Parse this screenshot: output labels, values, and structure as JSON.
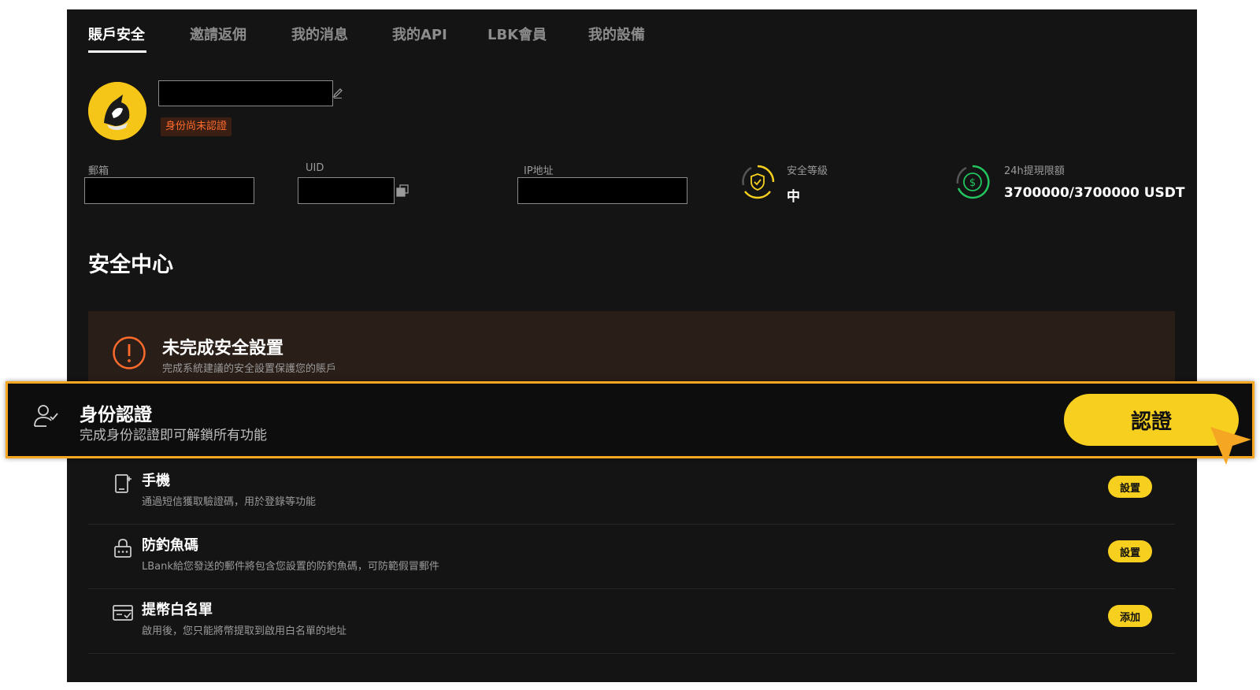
{
  "tabs": [
    "賬戶安全",
    "邀請返佣",
    "我的消息",
    "我的API",
    "LBK會員",
    "我的設備"
  ],
  "profile": {
    "status_badge": "身份尚未認證"
  },
  "fields": {
    "email_label": "郵箱",
    "uid_label": "UID",
    "ip_label": "IP地址"
  },
  "stats": {
    "security_level_label": "安全等級",
    "security_level_value": "中",
    "withdraw_limit_label": "24h提現限額",
    "withdraw_limit_value": "3700000/3700000 USDT"
  },
  "security_center": {
    "title": "安全中心",
    "warning_title": "未完成安全設置",
    "warning_sub": "完成系統建議的安全設置保護您的賬戶"
  },
  "identity": {
    "title": "身份認證",
    "subtitle": "完成身份認證即可解鎖所有功能",
    "button": "認證"
  },
  "rows": [
    {
      "title": "手機",
      "subtitle": "通過短信獲取驗證碼，用於登錄等功能",
      "button": "設置"
    },
    {
      "title": "防釣魚碼",
      "subtitle": "LBank給您發送的郵件將包含您設置的防釣魚碼，可防範假冒郵件",
      "button": "設置"
    },
    {
      "title": "提幣白名單",
      "subtitle": "啟用後，您只能將幣提取到啟用白名單的地址",
      "button": "添加"
    }
  ],
  "colors": {
    "accent_yellow": "#f7d01f",
    "highlight_orange": "#f5a623",
    "warning_orange": "#ff6b2c",
    "panel_bg": "#141414"
  }
}
